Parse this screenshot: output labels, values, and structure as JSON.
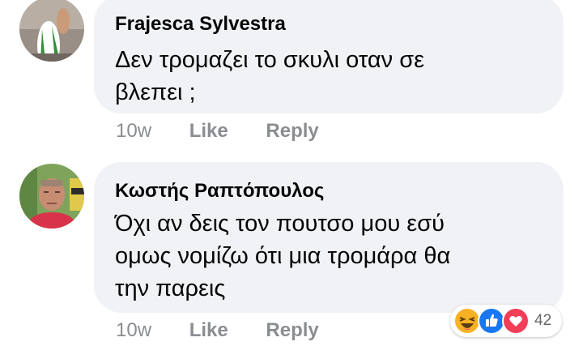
{
  "comments": [
    {
      "author": "Frajesca Sylvestra",
      "lines": [
        "Δεν τρομαζει το σκυλι οταν σε",
        "βλεπει ;"
      ],
      "time": "10w",
      "like_label": "Like",
      "reply_label": "Reply"
    },
    {
      "author": "Κωστής Ραπτόπουλος",
      "lines": [
        "Όχι αν δεις τον πουτσο μου εσύ",
        "ομως νομίζω ότι μια τρομάρα θα",
        "την παρεις"
      ],
      "time": "10w",
      "like_label": "Like",
      "reply_label": "Reply",
      "reactions": {
        "icons": [
          "haha-icon",
          "like-icon",
          "love-icon"
        ],
        "count": "42"
      }
    }
  ],
  "colors": {
    "bubble": "#f0f2f5",
    "meta_text": "#8a8d91",
    "like_blue": "#1877f2",
    "love_red": "#f33e58",
    "haha_yellow": "#f7b125"
  }
}
